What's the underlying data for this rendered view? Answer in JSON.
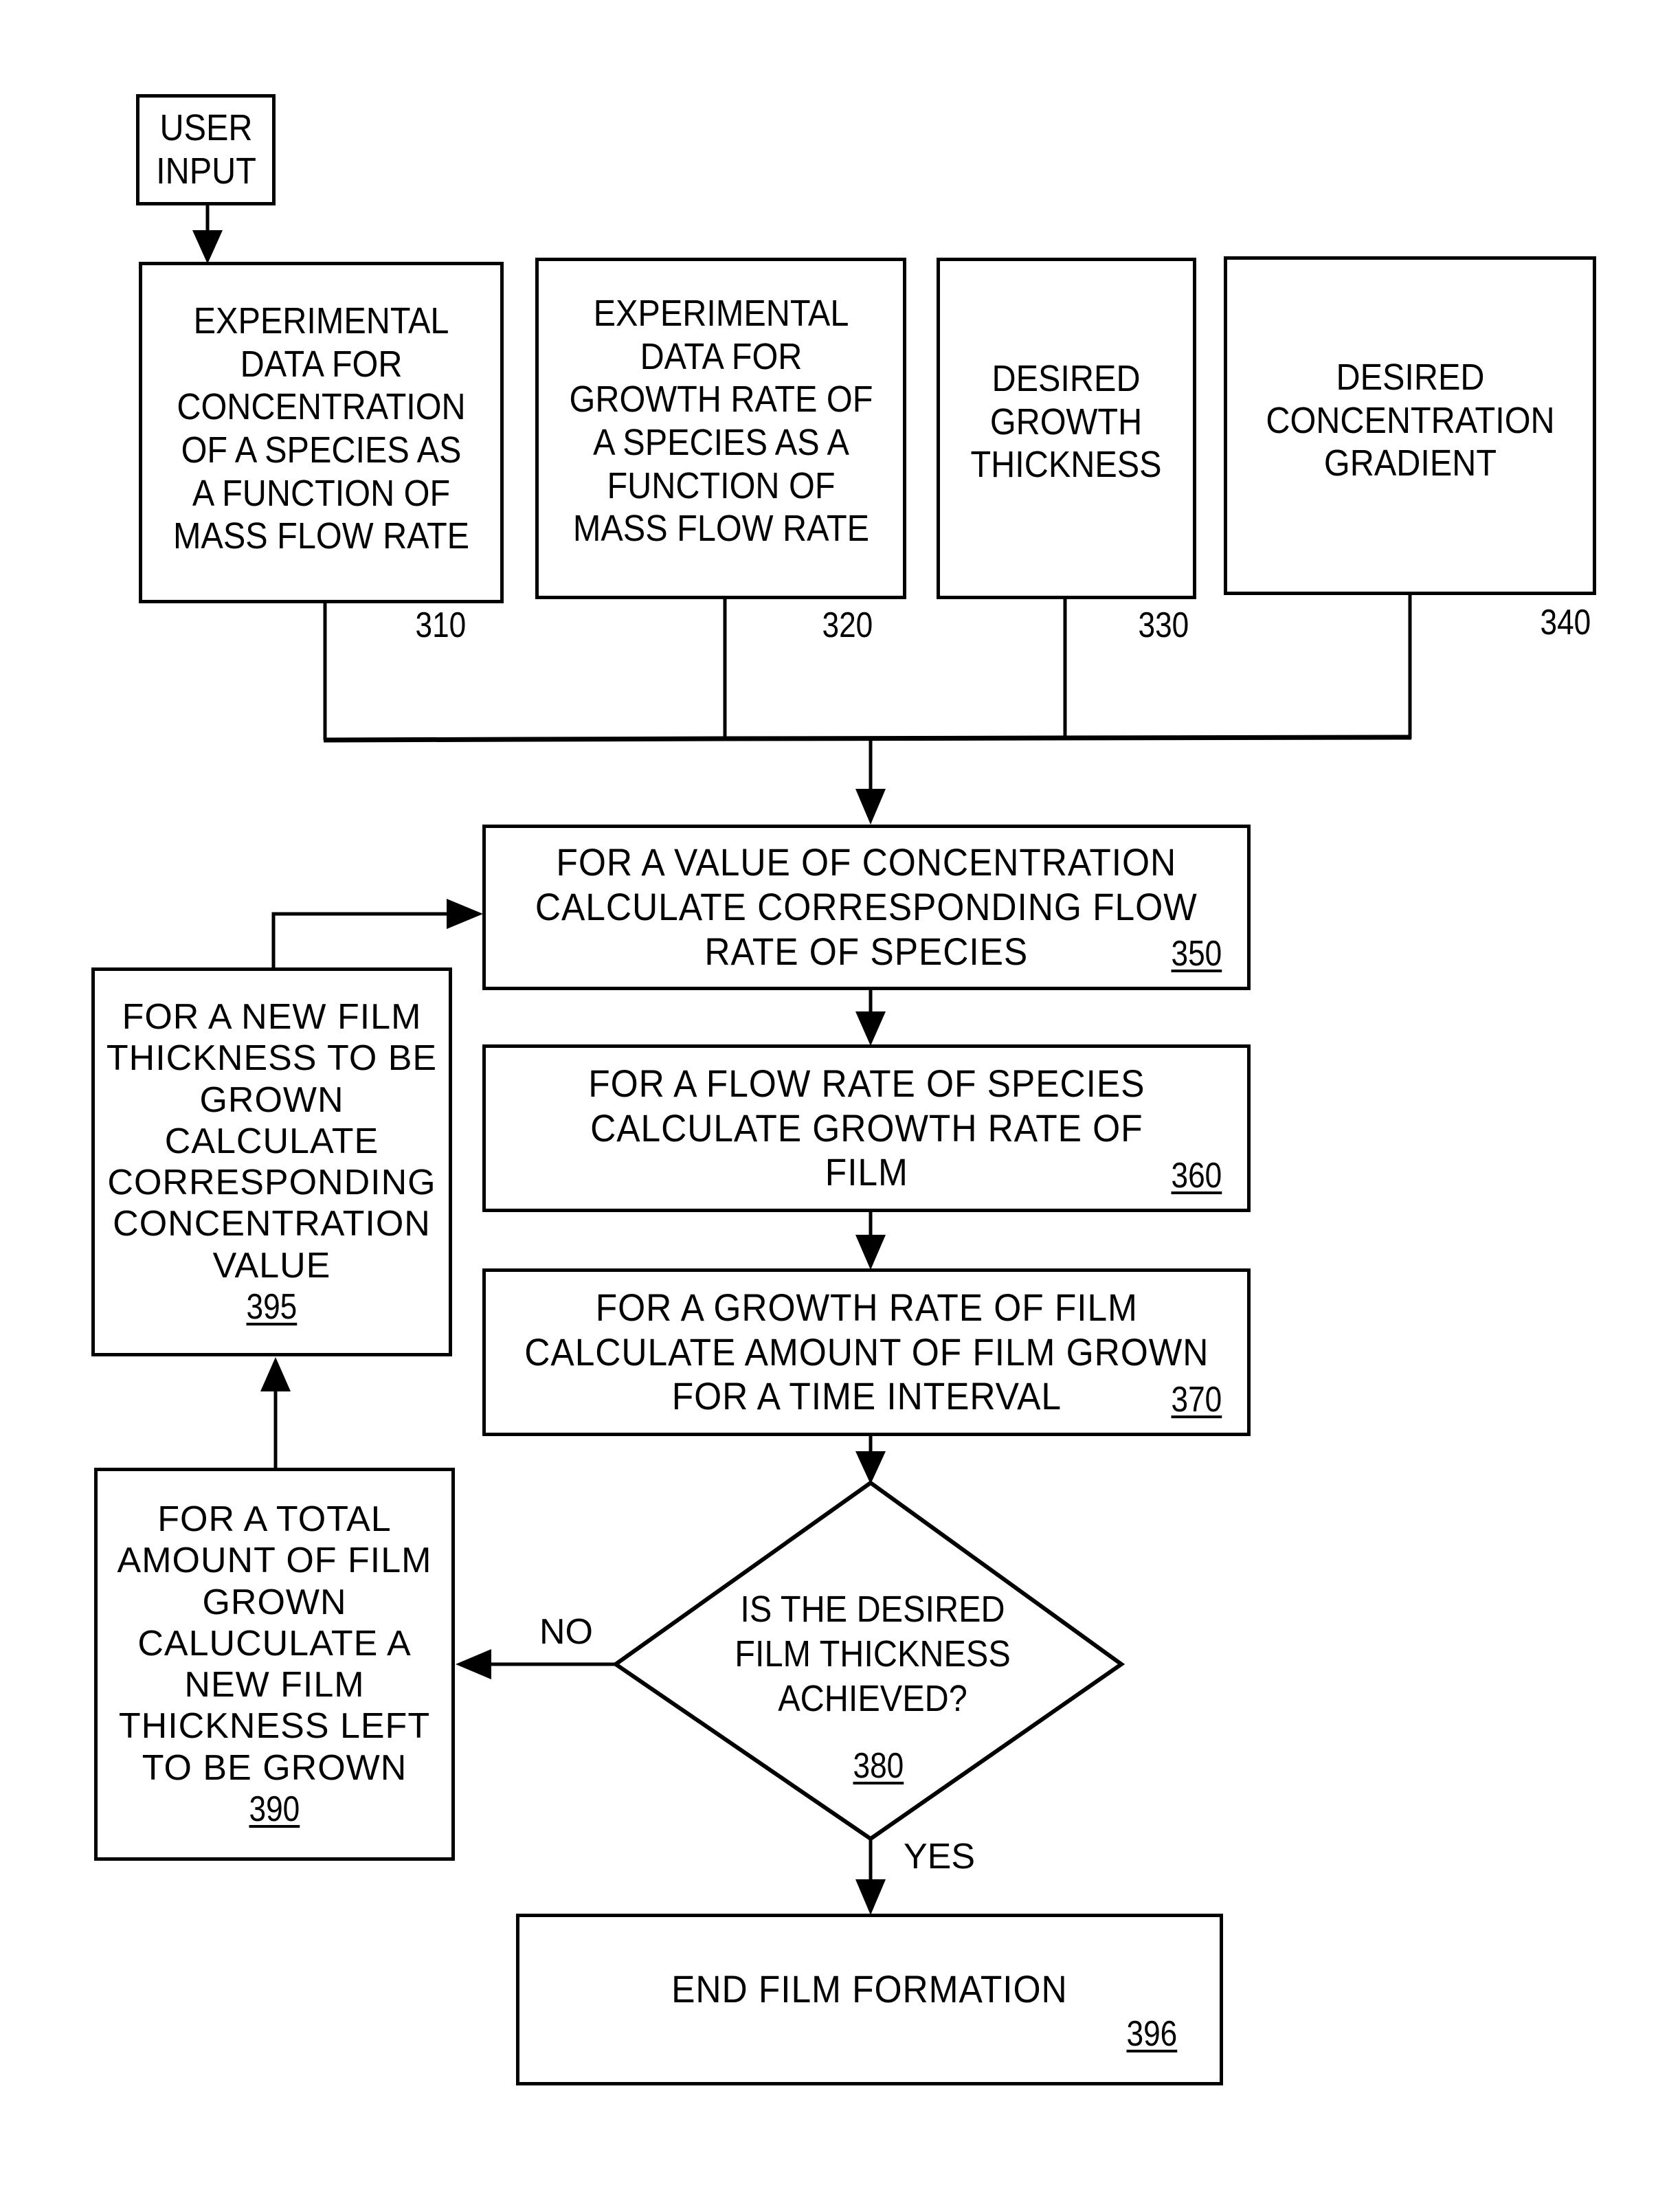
{
  "diagram": {
    "type": "flowchart",
    "nodes": {
      "user_input": {
        "text": "USER\nINPUT"
      },
      "n310": {
        "text": "EXPERIMENTAL\nDATA FOR\nCONCENTRATION\nOF A SPECIES AS\nA FUNCTION OF\nMASS FLOW RATE",
        "ref": "310"
      },
      "n320": {
        "text": "EXPERIMENTAL\nDATA FOR\nGROWTH RATE OF\nA SPECIES AS A\nFUNCTION OF\nMASS FLOW RATE",
        "ref": "320"
      },
      "n330": {
        "text": "DESIRED\nGROWTH\nTHICKNESS",
        "ref": "330"
      },
      "n340": {
        "text": "DESIRED\nCONCENTRATION\nGRADIENT",
        "ref": "340"
      },
      "n350": {
        "text": "FOR A VALUE OF CONCENTRATION\nCALCULATE CORRESPONDING FLOW\nRATE OF SPECIES",
        "ref": "350"
      },
      "n360": {
        "text": "FOR A FLOW RATE OF SPECIES\nCALCULATE GROWTH RATE OF\nFILM",
        "ref": "360"
      },
      "n370": {
        "text": "FOR A GROWTH RATE OF FILM\nCALCULATE AMOUNT OF FILM GROWN\nFOR A TIME INTERVAL",
        "ref": "370"
      },
      "n380": {
        "text": "IS THE DESIRED\nFILM THICKNESS\nACHIEVED?",
        "ref": "380"
      },
      "n390": {
        "text": "FOR A TOTAL\nAMOUNT OF FILM\nGROWN\nCALUCULATE A\nNEW FILM\nTHICKNESS LEFT\nTO BE GROWN",
        "ref": "390"
      },
      "n395": {
        "text": "FOR A NEW FILM\nTHICKNESS TO BE\nGROWN\nCALCULATE\nCORRESPONDING\nCONCENTRATION\nVALUE",
        "ref": "395"
      },
      "n396": {
        "text": "END FILM FORMATION",
        "ref": "396"
      }
    },
    "edge_labels": {
      "no": "NO",
      "yes": "YES"
    },
    "edges": [
      [
        "user_input",
        "n310"
      ],
      [
        "n310",
        "n350"
      ],
      [
        "n320",
        "n350"
      ],
      [
        "n330",
        "n350"
      ],
      [
        "n340",
        "n350"
      ],
      [
        "n350",
        "n360"
      ],
      [
        "n360",
        "n370"
      ],
      [
        "n370",
        "n380"
      ],
      [
        "n380",
        "n390",
        "NO"
      ],
      [
        "n380",
        "n396",
        "YES"
      ],
      [
        "n390",
        "n395"
      ],
      [
        "n395",
        "n350"
      ]
    ]
  }
}
